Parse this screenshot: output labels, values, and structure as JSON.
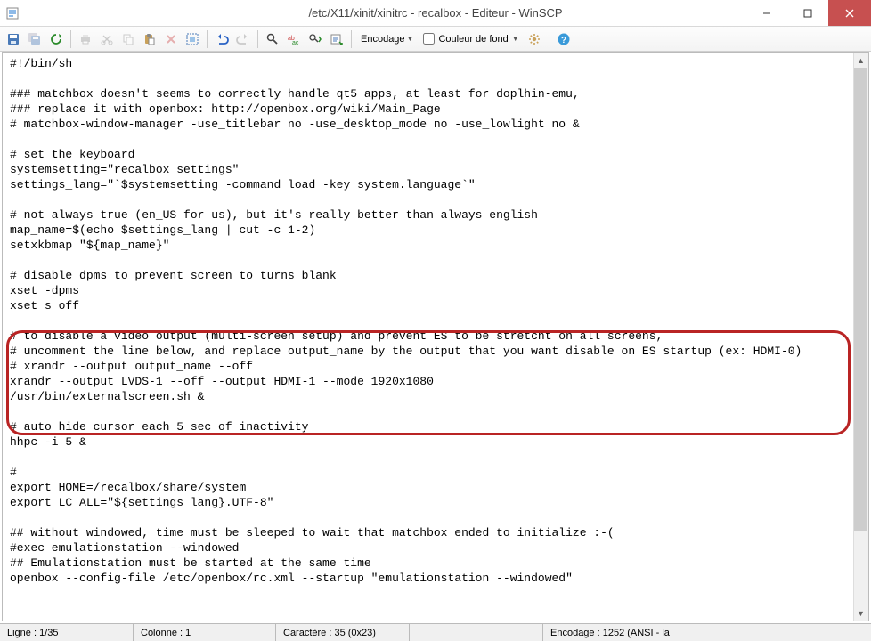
{
  "window": {
    "title": "/etc/X11/xinit/xinitrc - recalbox - Editeur - WinSCP"
  },
  "toolbar": {
    "encoding_label": "Encodage",
    "bgcolor_label": "Couleur de fond"
  },
  "editor": {
    "content": "#!/bin/sh\n\n### matchbox doesn't seems to correctly handle qt5 apps, at least for doplhin-emu,\n### replace it with openbox: http://openbox.org/wiki/Main_Page\n# matchbox-window-manager -use_titlebar no -use_desktop_mode no -use_lowlight no &\n\n# set the keyboard\nsystemsetting=\"recalbox_settings\"\nsettings_lang=\"`$systemsetting -command load -key system.language`\"\n\n# not always true (en_US for us), but it's really better than always english\nmap_name=$(echo $settings_lang | cut -c 1-2)\nsetxkbmap \"${map_name}\"\n\n# disable dpms to prevent screen to turns blank\nxset -dpms\nxset s off\n\n# to disable a video output (multi-screen setup) and prevent ES to be stretcht on all screens,\n# uncomment the line below, and replace output_name by the output that you want disable on ES startup (ex: HDMI-0)\n# xrandr --output output_name --off\nxrandr --output LVDS-1 --off --output HDMI-1 --mode 1920x1080\n/usr/bin/externalscreen.sh &\n\n# auto hide cursor each 5 sec of inactivity\nhhpc -i 5 &\n\n#\nexport HOME=/recalbox/share/system\nexport LC_ALL=\"${settings_lang}.UTF-8\"\n\n## without windowed, time must be sleeped to wait that matchbox ended to initialize :-(\n#exec emulationstation --windowed\n## Emulationstation must be started at the same time\nopenbox --config-file /etc/openbox/rc.xml --startup \"emulationstation --windowed\""
  },
  "status": {
    "line": "Ligne : 1/35",
    "column": "Colonne : 1",
    "char": "Caractère : 35 (0x23)",
    "encoding": "Encodage : 1252 (ANSI - la"
  }
}
